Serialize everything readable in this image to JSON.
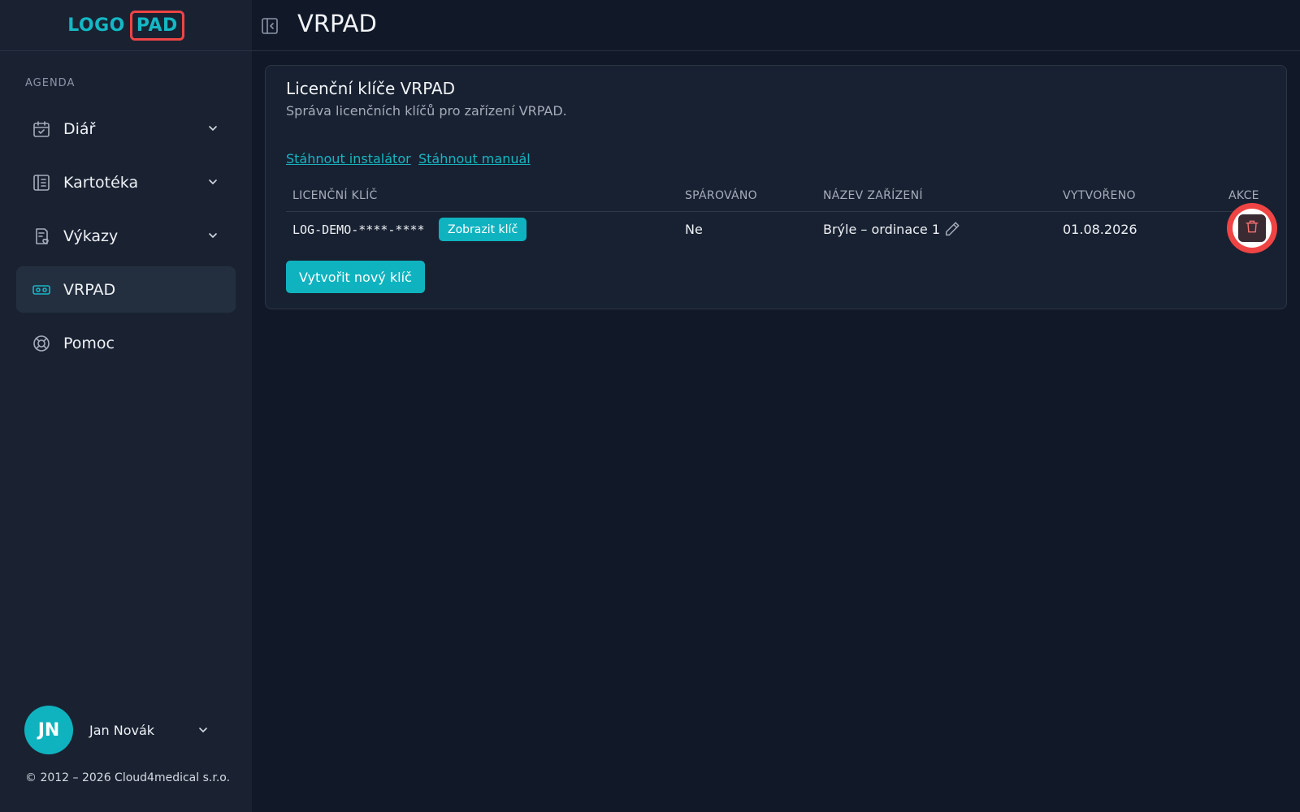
{
  "app": {
    "logo_left": "LOGO",
    "logo_right": "PAD"
  },
  "sidebar": {
    "section_label": "AGENDA",
    "items": [
      {
        "label": "Diář",
        "icon": "calendar-check-icon",
        "expandable": true
      },
      {
        "label": "Kartotéka",
        "icon": "notebook-icon",
        "expandable": true
      },
      {
        "label": "Výkazy",
        "icon": "report-icon",
        "expandable": true
      },
      {
        "label": "VRPAD",
        "icon": "vr-headset-icon",
        "expandable": false,
        "active": true
      },
      {
        "label": "Pomoc",
        "icon": "lifebuoy-icon",
        "expandable": false
      }
    ],
    "user": {
      "initials": "JN",
      "name": "Jan Novák"
    },
    "copyright": "© 2012 – 2026 Cloud4medical s.r.o."
  },
  "header": {
    "title": "VRPAD"
  },
  "card": {
    "title": "Licenční klíče VRPAD",
    "subtitle": "Správa licenčních klíčů pro zařízení VRPAD.",
    "links": {
      "installer": "Stáhnout instalátor",
      "manual": "Stáhnout manuál"
    },
    "table": {
      "columns": [
        "LICENČNÍ KLÍČ",
        "SPÁROVÁNO",
        "NÁZEV ZAŘÍZENÍ",
        "VYTVOŘENO",
        "AKCE"
      ],
      "rows": [
        {
          "key": "LOG-DEMO-****-****",
          "show_key_label": "Zobrazit klíč",
          "paired": "Ne",
          "device_name": "Brýle – ordinace 1",
          "created": "01.08.2026"
        }
      ]
    },
    "create_button": "Vytvořit nový klíč"
  },
  "colors": {
    "accent": "#0fb3bf",
    "highlight": "#ef4444",
    "background": "#111827",
    "sidebar": "#1a2232"
  }
}
